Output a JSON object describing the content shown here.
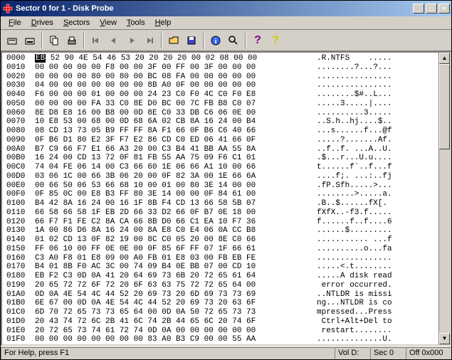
{
  "window": {
    "title": "Sector 0 for 1 - Disk Probe"
  },
  "menu": [
    "File",
    "Drives",
    "Sectors",
    "View",
    "Tools",
    "Help"
  ],
  "status": {
    "help": "For Help, press F1",
    "vol": "Vol D:",
    "sec": "Sec 0",
    "off": "Off 0x000"
  },
  "hex": [
    {
      "o": "0000",
      "b": "EB 52 90 4E 54 46 53 20 20 20 20 00 02 08 00 00",
      "a": ".R.NTFS    .....",
      "hl": true
    },
    {
      "o": "0010",
      "b": "00 00 00 00 00 F8 00 00 3F 00 FF 00 3F 00 00 00",
      "a": "........?...?..."
    },
    {
      "o": "0020",
      "b": "00 00 00 00 80 00 80 00 BC 08 FA 00 00 00 00 00",
      "a": "................"
    },
    {
      "o": "0030",
      "b": "04 00 00 00 00 00 00 00 8B A0 0F 00 00 00 00 00",
      "a": "................"
    },
    {
      "o": "0040",
      "b": "F6 00 00 00 01 00 00 00 24 23 C0 F0 4C C0 F0 E8",
      "a": "........$#..L..."
    },
    {
      "o": "0050",
      "b": "00 00 00 00 FA 33 C0 8E D0 BC 00 7C FB B8 C0 07",
      "a": ".....3.....|...."
    },
    {
      "o": "0060",
      "b": "8E D8 E8 16 00 B8 00 0D 8E C0 33 DB C6 06 0E 00",
      "a": "..........3....."
    },
    {
      "o": "0070",
      "b": "10 E8 53 00 68 00 0D 68 6A 02 CB 8A 16 24 00 B4",
      "a": "..S.h..hj....$.."
    },
    {
      "o": "0080",
      "b": "08 CD 13 73 05 B9 FF FF 8A F1 66 0F B6 C6 40 66",
      "a": "...s......f...@f"
    },
    {
      "o": "0090",
      "b": "0F B6 D1 80 E2 3F F7 E2 86 CD C0 ED 06 41 66 0F",
      "a": ".....?.......Af."
    },
    {
      "o": "00A0",
      "b": "B7 C9 66 F7 E1 66 A3 20 00 C3 B4 41 BB AA 55 8A",
      "a": "..f..f. ...A..U."
    },
    {
      "o": "00B0",
      "b": "16 24 00 CD 13 72 0F 81 FB 55 AA 75 09 F6 C1 01",
      "a": ".$...r...U.u...."
    },
    {
      "o": "00C0",
      "b": "74 04 FE 06 14 00 C3 66 60 1E 06 66 A1 10 00 66",
      "a": "t......f`..f...f"
    },
    {
      "o": "00D0",
      "b": "03 06 1C 00 66 3B 06 20 00 0F 82 3A 00 1E 66 6A",
      "a": "....f;. ...:..fj"
    },
    {
      "o": "00E0",
      "b": "00 66 50 06 53 66 68 10 00 01 00 80 3E 14 00 00",
      "a": ".fP.Sfh.....>..."
    },
    {
      "o": "00F0",
      "b": "0F 85 0C 00 E8 B3 FF 80 3E 14 00 00 0F 84 61 00",
      "a": "........>.....a."
    },
    {
      "o": "0100",
      "b": "B4 42 8A 16 24 00 16 1F 8B F4 CD 13 66 58 5B 07",
      "a": ".B..$......fX[."
    },
    {
      "o": "0110",
      "b": "66 58 66 58 1F EB 2D 66 33 D2 66 0F B7 0E 18 00",
      "a": "fXfX..-f3.f....."
    },
    {
      "o": "0120",
      "b": "66 F7 F1 FE C2 8A CA 66 8B D0 66 C1 EA 10 F7 36",
      "a": "f......f..f....6"
    },
    {
      "o": "0130",
      "b": "1A 00 86 D6 8A 16 24 00 8A E8 C0 E4 06 0A CC B8",
      "a": "......$........."
    },
    {
      "o": "0140",
      "b": "01 02 CD 13 0F 82 19 00 8C C0 05 20 00 8E C0 66",
      "a": "........... ...f"
    },
    {
      "o": "0150",
      "b": "FF 06 10 00 FF 0E 0E 00 0F 85 6F FF 07 1F 66 61",
      "a": "..........o...fa"
    },
    {
      "o": "0160",
      "b": "C3 A0 F8 01 E8 09 00 A0 FB 01 E8 03 00 FB EB FE",
      "a": "................"
    },
    {
      "o": "0170",
      "b": "B4 01 8B F0 AC 3C 00 74 09 B4 0E BB 07 00 CD 10",
      "a": ".....<.t........"
    },
    {
      "o": "0180",
      "b": "EB F2 C3 0D 0A 41 20 64 69 73 6B 20 72 65 61 64",
      "a": ".....A disk read"
    },
    {
      "o": "0190",
      "b": "20 65 72 72 6F 72 20 6F 63 63 75 72 72 65 64 00",
      "a": " error occurred."
    },
    {
      "o": "01A0",
      "b": "0D 0A 4E 54 4C 44 52 20 69 73 20 6D 69 73 73 69",
      "a": "..NTLDR is missi"
    },
    {
      "o": "01B0",
      "b": "6E 67 00 0D 0A 4E 54 4C 44 52 20 69 73 20 63 6F",
      "a": "ng...NTLDR is co"
    },
    {
      "o": "01C0",
      "b": "6D 70 72 65 73 73 65 64 00 0D 0A 50 72 65 73 73",
      "a": "mpressed...Press"
    },
    {
      "o": "01D0",
      "b": "20 43 74 72 6C 2B 41 6C 74 2B 44 65 6C 20 74 6F",
      "a": " Ctrl+Alt+Del to"
    },
    {
      "o": "01E0",
      "b": "20 72 65 73 74 61 72 74 0D 0A 00 00 00 00 00 00",
      "a": " restart........"
    },
    {
      "o": "01F0",
      "b": "00 00 00 00 00 00 00 00 83 A0 B3 C9 00 00 55 AA",
      "a": "..............U."
    }
  ]
}
